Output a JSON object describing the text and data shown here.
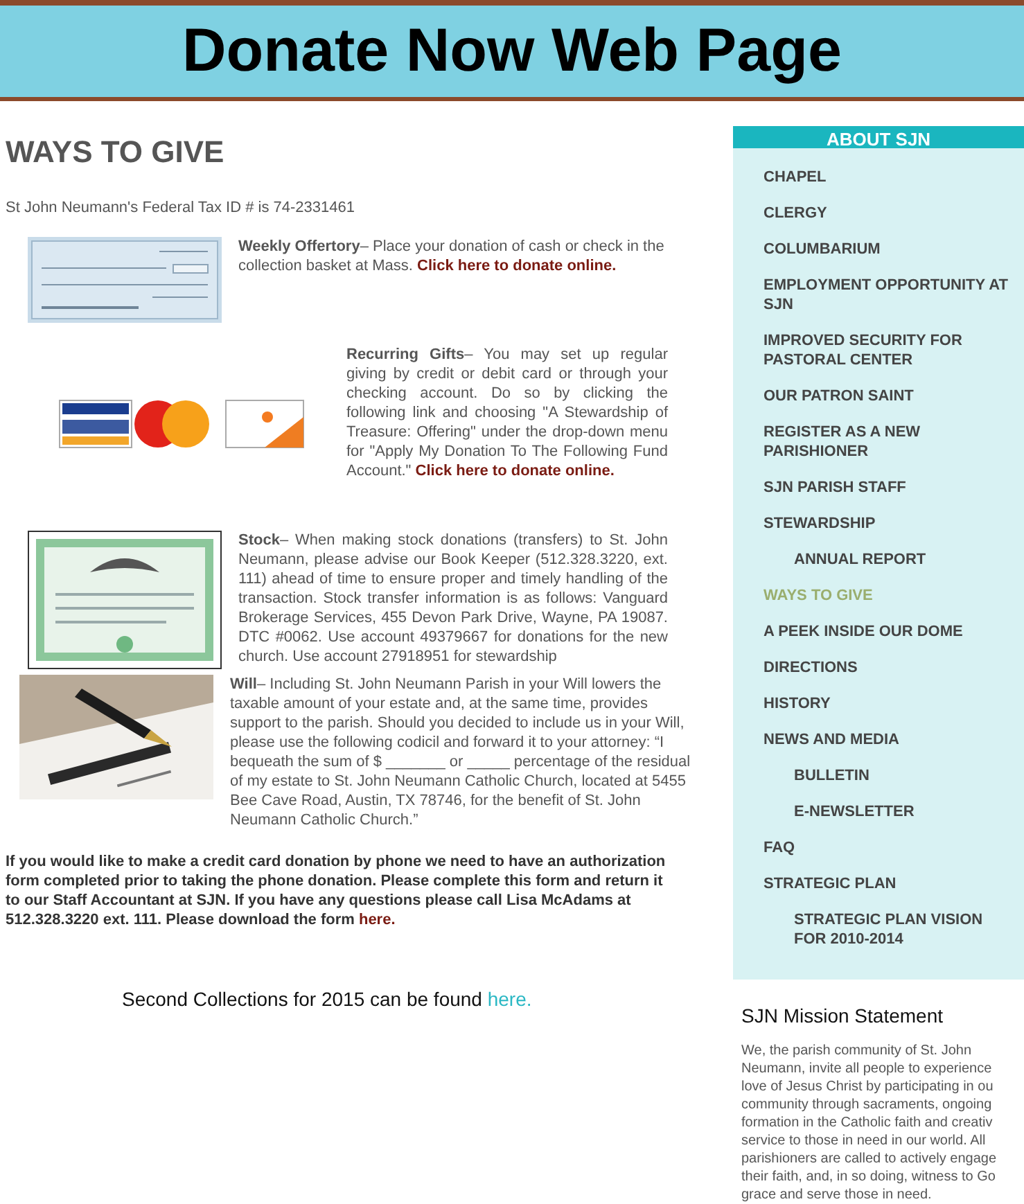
{
  "banner": {
    "title": "Donate Now Web Page"
  },
  "main": {
    "heading": "WAYS TO GIVE",
    "tax_id": "St John Neumann's Federal Tax ID # is 74-2331461",
    "sections": [
      {
        "kind": "check",
        "text": "**Weekly Offertory**– Place your donation of cash or check in the collection basket at Mass. ",
        "link": "Click here to donate online."
      },
      {
        "kind": "cards",
        "text": "**Recurring Gifts**– You may set up regular giving by credit or debit card or through your checking account. Do so by clicking the following link and choosing  \"A Stewardship of Treasure: Offering\" under the drop-down menu for \"Apply My Donation To The Following Fund Account.\" ",
        "link": "Click here to donate online."
      },
      {
        "kind": "stock",
        "text": "**Stock**– When making stock donations (transfers) to St. John Neumann, please advise our Book Keeper (512.328.3220, ext. 111) ahead of time to ensure proper and timely handling of the transaction. Stock transfer information is as follows: Vanguard Brokerage Services, 455 Devon Park Drive, Wayne, PA 19087. DTC #0062. Use account 49379667 for donations for the new church. Use account 27918951 for stewardship"
      },
      {
        "kind": "will",
        "text": "**Will**– Including St. John Neumann Parish in your Will lowers the taxable amount of your estate and, at the same time, provides support to the parish.  Should you decided to include us in your Will, please use the following codicil and forward it to your attorney: “I bequeath the sum of $ _______ or _____ percentage of the residual of my estate to St. John Neumann Catholic Church, located at 5455 Bee Cave Road, Austin, TX 78746, for the benefit of St. John Neumann Catholic Church.”"
      }
    ],
    "phone_note": {
      "text": "If you would like to make a credit card donation by phone we need to have an authorization form completed prior to taking the phone donation. Please complete this form and return it to our Staff Accountant at SJN. If you have any questions please call Lisa McAdams at 512.328.3220 ext. 111. Please download the form ",
      "link": "here."
    },
    "second_collections": {
      "text": "Second Collections for 2015 can be found ",
      "link": "here."
    }
  },
  "sidebar": {
    "title": "ABOUT SJN",
    "items": [
      {
        "label": "CHAPEL",
        "selected": false
      },
      {
        "label": "CLERGY",
        "selected": false
      },
      {
        "label": "COLUMBARIUM",
        "selected": false
      },
      {
        "label": "EMPLOYMENT OPPORTUNITY AT SJN",
        "selected": false
      },
      {
        "label": "IMPROVED SECURITY FOR PASTORAL CENTER",
        "selected": false
      },
      {
        "label": "OUR PATRON SAINT",
        "selected": false
      },
      {
        "label": "REGISTER AS A NEW PARISHIONER",
        "selected": false
      },
      {
        "label": "SJN PARISH STAFF",
        "selected": false
      },
      {
        "label": "STEWARDSHIP",
        "selected": false,
        "children": [
          {
            "label": "ANNUAL REPORT",
            "selected": false
          }
        ]
      },
      {
        "label": "WAYS TO GIVE",
        "selected": true
      },
      {
        "label": "A PEEK INSIDE OUR DOME",
        "selected": false
      },
      {
        "label": "DIRECTIONS",
        "selected": false
      },
      {
        "label": "HISTORY",
        "selected": false
      },
      {
        "label": "NEWS AND MEDIA",
        "selected": false,
        "children": [
          {
            "label": "BULLETIN",
            "selected": false
          },
          {
            "label": "E-NEWSLETTER",
            "selected": false
          }
        ]
      },
      {
        "label": "FAQ",
        "selected": false
      },
      {
        "label": "STRATEGIC PLAN",
        "selected": false,
        "children": [
          {
            "label": "STRATEGIC PLAN VISION FOR 2010-2014",
            "selected": false
          }
        ]
      }
    ]
  },
  "mission": {
    "title": "SJN Mission Statement",
    "lines": [
      "We, the parish community of St. John",
      "Neumann, invite all people to experience",
      "love of Jesus Christ by participating in ou",
      "community through sacraments, ongoing",
      "formation in the Catholic faith and creativ",
      "service to those in need in our world. All",
      "parishioners are called to actively engage",
      "their faith, and, in so doing, witness to Go",
      "grace and serve those in need."
    ]
  }
}
